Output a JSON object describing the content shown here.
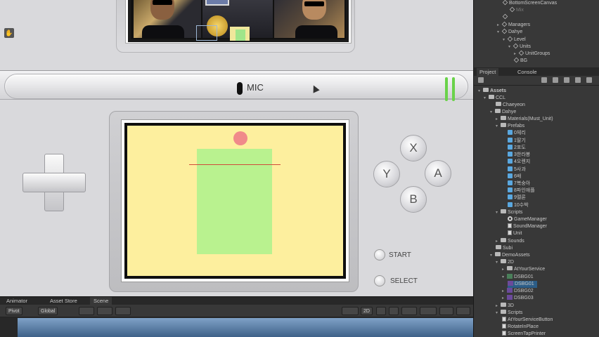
{
  "game": {
    "mic_label": "MIC",
    "buttons": {
      "x": "X",
      "y": "Y",
      "a": "A",
      "b": "B",
      "start": "START",
      "select": "SELECT"
    }
  },
  "hierarchy": {
    "rows": [
      {
        "label": "BottomScreenCanvas"
      },
      {
        "label": "Mix"
      },
      {
        "label": ""
      },
      {
        "label": "Managers"
      },
      {
        "label": "Dahye"
      },
      {
        "label": "Level"
      },
      {
        "label": "Units"
      },
      {
        "label": "UnitGroups"
      },
      {
        "label": "BG"
      }
    ]
  },
  "project": {
    "tabs": [
      "Project",
      "Console"
    ],
    "items": [
      "Assets",
      "CCL",
      "Chaeyeon",
      "Dahye",
      "Materials(Must_Unit)",
      "Prefabs",
      "0체리",
      "1딸기",
      "2포도",
      "3한라봉",
      "4오렌지",
      "5사과",
      "6배",
      "7복숭아",
      "8파인애플",
      "9멜론",
      "10수박",
      "Scripts",
      "GameManager",
      "SoundManager",
      "Unit",
      "Sounds",
      "Subi",
      "DemoAssets",
      "2D",
      "AtYourService",
      "DSBG01",
      "DSBG01",
      "DSBG02",
      "DSBG03",
      "3D",
      "Scripts",
      "AtYourServiceButton",
      "RotateInPlace",
      "ScreenTapPrinter"
    ]
  },
  "scene_panel": {
    "tabs": [
      "Animator",
      "Asset Store",
      "Scene"
    ],
    "toolbar": {
      "pivot": "Pivot",
      "global": "Global",
      "mode_2d": "2D"
    }
  }
}
